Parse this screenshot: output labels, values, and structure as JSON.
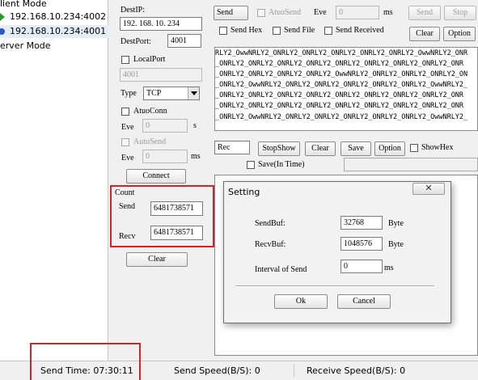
{
  "tree": {
    "items": [
      {
        "label": "lient Mode"
      },
      {
        "label": "192.168.10.234:4002"
      },
      {
        "label": "192.168.10.234:4001"
      },
      {
        "label": "erver Mode"
      }
    ]
  },
  "conn": {
    "destip_label": "DestIP:",
    "destip_value": "192. 168. 10. 234",
    "destport_label": "DestPort:",
    "destport_value": "4001",
    "localport_label": "LocalPort",
    "localport_value": "4001",
    "type_label": "Type",
    "type_value": "TCP",
    "atuoconn_label": "AtuoConn",
    "eve_label": "Eve",
    "eve_value": "0",
    "eve_unit": "s",
    "autosend_label": "AutoSend",
    "eve2_label": "Eve",
    "eve2_value": "0",
    "eve2_unit": "ms",
    "connect_label": "Connect"
  },
  "count": {
    "title": "Count",
    "send_label": "Send",
    "send_value": "6481738571",
    "recv_label": "Recv",
    "recv_value": "6481738571",
    "clear_label": "Clear"
  },
  "sendbar": {
    "send_label": "Send",
    "atuosend_label": "AtuoSend",
    "eve_label": "Eve",
    "eve_value": "0",
    "ms_label": "ms",
    "send2_label": "Send",
    "stop_label": "Stop",
    "sendhex_label": "Send Hex",
    "sendfile_label": "Send File",
    "sendreceived_label": "Send Received",
    "clear_label": "Clear",
    "option_label": "Option"
  },
  "textarea": {
    "lines": [
      "RLY2_OwwNRLY2_ONRLY2_ONRLY2_ONRLY2_ONRLY2_ONRLY2_OwwNRLY2_ONR",
      "_ONRLY2_ONRLY2_ONRLY2_ONRLY2_ONRLY2_ONRLY2_ONRLY2_ONRLY2_ONR",
      "_ONRLY2_ONRLY2_ONRLY2_ONRLY2_OwwNRLY2_ONRLY2_ONRLY2_ONRLY2_ON",
      "_ONRLY2_OwwNRLY2_ONRLY2_ONRLY2_ONRLY2_ONRLY2_ONRLY2_OwwNRLY2_",
      "_ONRLY2_ONRLY2_ONRLY2_ONRLY2_ONRLY2_ONRLY2_ONRLY2_ONRLY2_ONR",
      "_ONRLY2_ONRLY2_ONRLY2_ONRLY2_ONRLY2_ONRLY2_ONRLY2_ONRLY2_ONR",
      "_ONRLY2_OwwNRLY2_ONRLY2_ONRLY2_ONRLY2_ONRLY2_ONRLY2_OwwNRLY2_"
    ]
  },
  "recvbar": {
    "rec_label": "Rec",
    "stopshow_label": "StopShow",
    "clear_label": "Clear",
    "save_label": "Save",
    "option_label": "Option",
    "showhex_label": "ShowHex",
    "savein_label": "Save(In Time)"
  },
  "dialog": {
    "title": "Setting",
    "sendbuf_label": "SendBuf:",
    "sendbuf_value": "32768",
    "sendbuf_unit": "Byte",
    "recvbuf_label": "RecvBuf:",
    "recvbuf_value": "1048576",
    "recvbuf_unit": "Byte",
    "interval_label": "Interval of Send",
    "interval_value": "0",
    "interval_unit": "ms",
    "ok_label": "Ok",
    "cancel_label": "Cancel"
  },
  "status": {
    "send_time": "Send Time: 07:30:11",
    "send_speed": "Send Speed(B/S): 0",
    "recv_speed": "Receive Speed(B/S): 0"
  },
  "colors": {
    "highlight": "#d42424",
    "arrow_green": "#2e9a2e",
    "arrow_blue": "#2a56c6"
  }
}
